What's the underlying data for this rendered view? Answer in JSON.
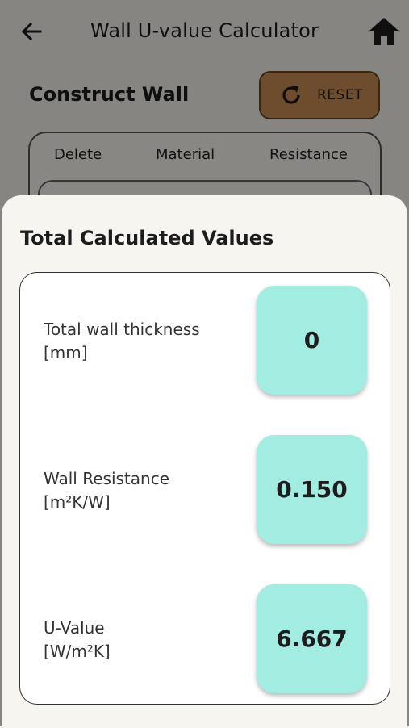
{
  "header": {
    "title": "Wall U-value Calculator",
    "back_icon": "back-arrow-icon",
    "home_icon": "home-icon"
  },
  "construct": {
    "title": "Construct Wall",
    "reset_label": "RESET",
    "reset_icon": "refresh-icon",
    "reset_color": "#c98f55",
    "columns": [
      "Delete",
      "Material",
      "Resistance"
    ]
  },
  "sheet": {
    "title": "Total Calculated Values",
    "rows": [
      {
        "label_line1": "Total wall thickness",
        "label_line2": "[mm]",
        "value": "0"
      },
      {
        "label_line1": "Wall Resistance",
        "label_line2": "[m²K/W]",
        "value": "0.150"
      },
      {
        "label_line1": "U-Value",
        "label_line2": "[W/m²K]",
        "value": "6.667"
      }
    ],
    "value_box_color": "#a3ece2"
  }
}
